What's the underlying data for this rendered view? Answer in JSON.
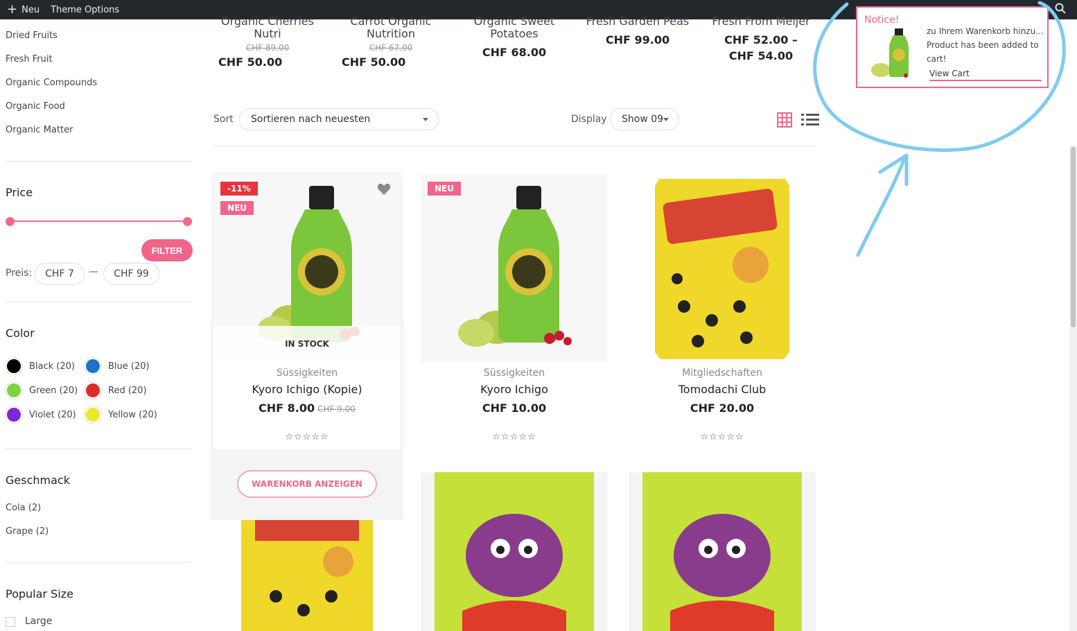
{
  "adminbar": {
    "new_label": "Neu",
    "theme_options": "Theme Options"
  },
  "sidebar": {
    "categories": [
      "Dried Fruits",
      "Fresh Fruit",
      "Organic Compounds",
      "Organic Food",
      "Organic Matter"
    ],
    "price": {
      "title": "Price",
      "filter_label": "FILTER",
      "preis_label": "Preis:",
      "min": "CHF 7",
      "max": "CHF 99",
      "dash": "—"
    },
    "color": {
      "title": "Color",
      "items": [
        {
          "label": "Black (20)",
          "hex": "#000000"
        },
        {
          "label": "Blue (20)",
          "hex": "#1a73c9"
        },
        {
          "label": "Green (20)",
          "hex": "#7bd43f"
        },
        {
          "label": "Red (20)",
          "hex": "#e02a2a"
        },
        {
          "label": "Violet (20)",
          "hex": "#7d28d9"
        },
        {
          "label": "Yellow (20)",
          "hex": "#eaea2a"
        }
      ]
    },
    "geschmack": {
      "title": "Geschmack",
      "items": [
        "Cola (2)",
        "Grape (2)"
      ]
    },
    "size": {
      "title": "Popular Size",
      "items": [
        "Large"
      ]
    }
  },
  "top_products": [
    {
      "name1": "Organic Cherries",
      "name2": "Nutri",
      "old": "CHF 89.00",
      "price": "CHF 50.00"
    },
    {
      "name1": "Carrot Organic",
      "name2": "Nutrition",
      "old": "CHF 67.00",
      "price": "CHF 50.00"
    },
    {
      "name1": "Organic Sweet",
      "name2": "Potatoes",
      "old": "",
      "price": "CHF 68.00"
    },
    {
      "name1": "Fresh Garden Peas",
      "name2": "",
      "old": "",
      "price": "CHF 99.00"
    },
    {
      "name1": "Fresh From Meijer",
      "name2": "",
      "old": "",
      "price": "CHF 52.00 –",
      "price2": "CHF 54.00"
    }
  ],
  "toolbar": {
    "sort_label": "Sort",
    "sort_value": "Sortieren nach neuesten",
    "display_label": "Display",
    "display_value": "Show 09"
  },
  "products": [
    {
      "badges": [
        "-11%",
        "NEU"
      ],
      "stock": "IN STOCK",
      "category": "Süssigkeiten",
      "title": "Kyoro Ichigo (Kopie)",
      "price": "CHF 8.00",
      "was": "CHF 9.00",
      "stars": "☆☆☆☆☆",
      "cart_label": "WARENKORB ANZEIGEN"
    },
    {
      "badges": [
        "NEU"
      ],
      "category": "Süssigkeiten",
      "title": "Kyoro Ichigo",
      "price": "CHF 10.00",
      "stars": "☆☆☆☆☆"
    },
    {
      "badges": [],
      "category": "Mitgliedschaften",
      "title": "Tomodachi Club",
      "price": "CHF 20.00",
      "stars": "☆☆☆☆☆"
    }
  ],
  "notice": {
    "title": "Notice!",
    "line1": "zu Ihrem Warenkorb hinzu...",
    "line2": "Product has been added to cart!",
    "link": "View Cart"
  }
}
